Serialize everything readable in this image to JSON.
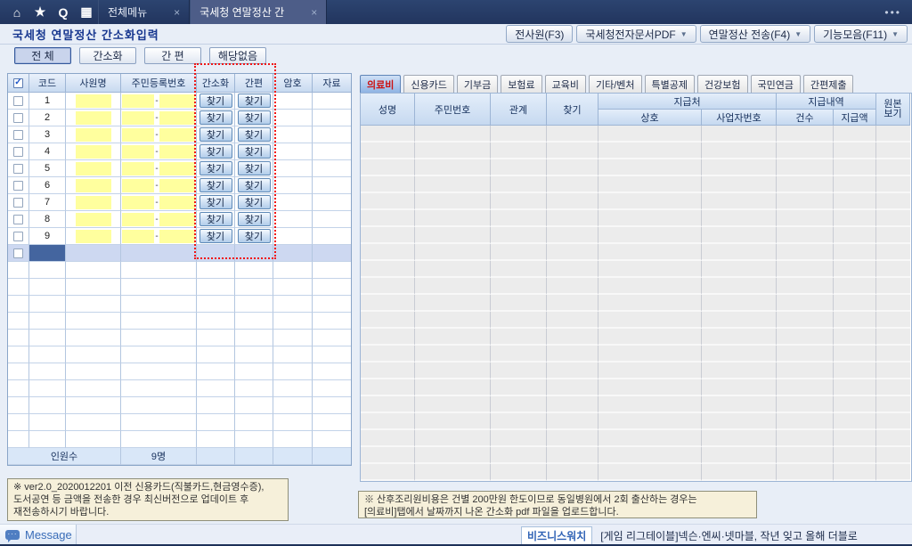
{
  "topbar": {
    "icons": [
      {
        "name": "home-icon",
        "glyph": "⌂"
      },
      {
        "name": "star-icon",
        "glyph": "★"
      },
      {
        "name": "search-icon",
        "glyph": "Q"
      },
      {
        "name": "grid-menu-icon",
        "glyph": "▦"
      }
    ],
    "tabs": [
      {
        "name": "tab-all-menu",
        "label": "전체메뉴",
        "active": false
      },
      {
        "name": "tab-nts-yearend",
        "label": "국세청 연말정산 간",
        "active": true
      }
    ],
    "close_glyph": "×",
    "overflow_glyph": "•••"
  },
  "titlebar": {
    "title": "국세청 연말정산 간소화입력",
    "buttons": [
      {
        "name": "all-employees-f3-button",
        "label": "전사원(F3)",
        "dropdown": false
      },
      {
        "name": "nts-edoc-pdf-button",
        "label": "국세청전자문서PDF",
        "dropdown": true
      },
      {
        "name": "yearend-send-f4-button",
        "label": "연말정산 전송(F4)",
        "dropdown": true
      },
      {
        "name": "functions-f11-button",
        "label": "기능모음(F11)",
        "dropdown": true
      }
    ],
    "caret_glyph": "▼"
  },
  "left_panel": {
    "filters": [
      {
        "name": "filter-all",
        "label": "전 체",
        "selected": true
      },
      {
        "name": "filter-simplified",
        "label": "간소화",
        "selected": false
      },
      {
        "name": "filter-easy",
        "label": "간 편",
        "selected": false
      },
      {
        "name": "filter-not-applicable",
        "label": "해당없음",
        "selected": false
      }
    ],
    "table": {
      "headers": [
        "코드",
        "사원명",
        "주민등록번호",
        "간소화",
        "간편",
        "암호",
        "자료"
      ],
      "select_all_checked": "✓",
      "find_label": "찾기",
      "rows": [
        {
          "code": "1"
        },
        {
          "code": "2"
        },
        {
          "code": "3"
        },
        {
          "code": "4"
        },
        {
          "code": "5"
        },
        {
          "code": "6"
        },
        {
          "code": "7"
        },
        {
          "code": "8"
        },
        {
          "code": "9"
        }
      ],
      "rrn_separator": "-",
      "summary": {
        "label": "인원수",
        "value": "9명"
      }
    },
    "note": "※ ver2.0_2020012201 이전 신용카드(직불카드,현금영수증),\n도서공연 등 금액을 전송한 경우 최신버전으로 업데이트 후\n재전송하시기 바랍니다."
  },
  "right_panel": {
    "tabs": [
      {
        "name": "tab-medical",
        "label": "의료비",
        "active": true
      },
      {
        "name": "tab-credit-card",
        "label": "신용카드",
        "active": false
      },
      {
        "name": "tab-donation",
        "label": "기부금",
        "active": false
      },
      {
        "name": "tab-insurance",
        "label": "보험료",
        "active": false
      },
      {
        "name": "tab-education",
        "label": "교육비",
        "active": false
      },
      {
        "name": "tab-etc-venture",
        "label": "기타/벤처",
        "active": false
      },
      {
        "name": "tab-special-deduction",
        "label": "특별공제",
        "active": false
      },
      {
        "name": "tab-health-insurance",
        "label": "건강보험",
        "active": false
      },
      {
        "name": "tab-national-pension",
        "label": "국민연금",
        "active": false
      },
      {
        "name": "tab-easy-submit",
        "label": "간편제출",
        "active": false
      }
    ],
    "table": {
      "headers": {
        "name": "성명",
        "rrn": "주민번호",
        "relation": "관계",
        "find": "찾기",
        "payer_group": "지급처",
        "payer_name": "상호",
        "payer_biz_no": "사업자번호",
        "detail_group": "지급내역",
        "count": "건수",
        "amount": "지급액",
        "original_view": "원본\n보기"
      }
    },
    "note": "※ 산후조리원비용은 건별 200만원 한도이므로 동일병원에서 2회 출산하는 경우는\n [의료비]탭에서 날짜까지 나온 간소화 pdf 파일을 업로드합니다."
  },
  "statusbar": {
    "message_label": "Message",
    "message_bubble_glyph": "···",
    "ticker_source": "비즈니스워치",
    "ticker_text": "[게임 리그테이블]넥슨·엔씨·넷마블, 작년 잊고 올해 더블로"
  }
}
